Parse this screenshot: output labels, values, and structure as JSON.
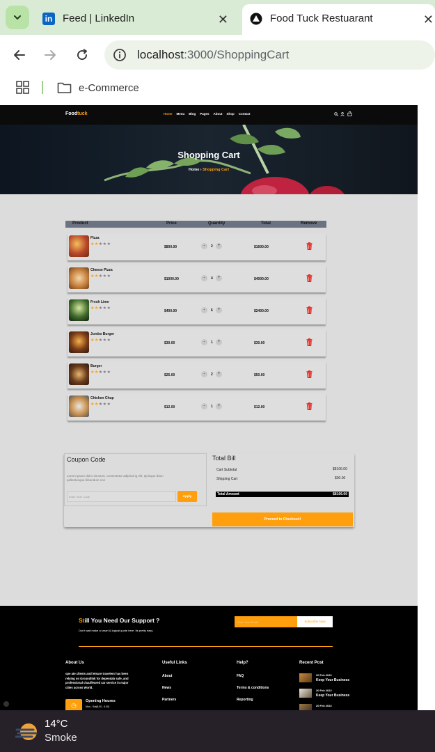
{
  "browser": {
    "tabs": [
      {
        "title": "Feed | LinkedIn",
        "icon": "linkedin-icon"
      },
      {
        "title": "Food Tuck Restuarant",
        "icon": "vercel-triangle-icon"
      }
    ],
    "url_host": "localhost",
    "url_path": ":3000/ShoppingCart",
    "bookmark_folder": "e-Commerce"
  },
  "site": {
    "logo_part1": "Food",
    "logo_part2": "tuck",
    "nav": [
      "Home",
      "Menu",
      "Blog",
      "Pages",
      "About",
      "Shop",
      "Contact"
    ],
    "hero_title": "Shopping Cart",
    "breadcrumb_home": "Home",
    "breadcrumb_sep": " › ",
    "breadcrumb_current": "Shopping Cart"
  },
  "cart": {
    "headers": {
      "product": "Product",
      "price": "Price",
      "quantity": "Quantity",
      "total": "Total",
      "remove": "Remove"
    },
    "items": [
      {
        "name": "Pizza",
        "price": "$800.00",
        "qty": "2",
        "total": "$1600.00",
        "rating": 2
      },
      {
        "name": "Cheese Pizza",
        "price": "$1000.00",
        "qty": "4",
        "total": "$4000.00",
        "rating": 2
      },
      {
        "name": "Fresh Lime",
        "price": "$400.00",
        "qty": "6",
        "total": "$2400.00",
        "rating": 2
      },
      {
        "name": "Jumbo Burger",
        "price": "$30.00",
        "qty": "1",
        "total": "$30.00",
        "rating": 2
      },
      {
        "name": "Burger",
        "price": "$25.00",
        "qty": "2",
        "total": "$50.00",
        "rating": 2
      },
      {
        "name": "Chicken Chup",
        "price": "$12.00",
        "qty": "1",
        "total": "$12.00",
        "rating": 2
      }
    ],
    "minus": "-",
    "plus": "+"
  },
  "coupon": {
    "title": "Coupon Code",
    "desc": "Lorem ipsum dolor sit amet, consectetur adipiscing elit. Quisque diam pellentesque bibendum non",
    "placeholder": "Enter Here Code",
    "apply": "Apply"
  },
  "bill": {
    "title": "Total Bill",
    "subtotal_label": "Cart Subtotal",
    "subtotal": "$8106.00",
    "shipping_label": "Shipping Cart",
    "shipping": "$00.00",
    "total_label": "Total Amount",
    "total": "$8106.00",
    "checkout": "Proceed to Checkout"
  },
  "footer": {
    "support_title_a": "St",
    "support_title_b": "ill You Need Our Support ?",
    "support_sub": "Don't wait make a smart & logical quote here. Its pretty easy.",
    "email_placeholder": "Enter Your Email",
    "subscribe": "Subscribe Now",
    "about_title": "About Us",
    "about_text": "ope ate clients and leisure travelers has been relying on Groundlink for dependab safe, and professional chauffeured car service in major cities across World.",
    "hours_title": "Opening Houres",
    "hours_text": "Mon - Sat(8.00 - 6.00)",
    "links_title": "Useful Links",
    "links": [
      "About",
      "News",
      "Partners"
    ],
    "help_title": "Help?",
    "help": [
      "FAQ",
      "Terms & conditions",
      "Reporting"
    ],
    "recent_title": "Recent Post",
    "posts": [
      {
        "date": "20 Feb 2022",
        "title": "Keep Your Business"
      },
      {
        "date": "20 Feb 2022",
        "title": "Keep Your Business"
      },
      {
        "date": "20 Feb 2022",
        "title": ""
      }
    ]
  },
  "taskbar": {
    "temp": "14°C",
    "condition": "Smoke"
  },
  "colors": {
    "accent": "#ff9f0d",
    "remove": "#e0231a",
    "tab_bar": "#d9ebd4"
  }
}
